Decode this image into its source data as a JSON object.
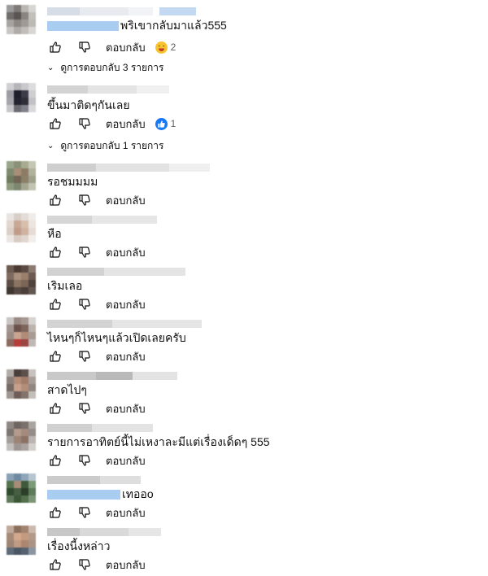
{
  "ui": {
    "reply_label": "ตอบกลับ"
  },
  "comments": [
    {
      "text": "พริเขากลับมาแล้ว555",
      "reaction_count": "2",
      "reaction_icon": "laughing-emoji-icon",
      "replies_label": "ดูการตอบกลับ 3 รายการ"
    },
    {
      "text": "ขึ้นมาติดๆกันเลย",
      "reaction_count": "1",
      "reaction_icon": "thumbs-up-reaction-icon",
      "replies_label": "ดูการตอบกลับ 1 รายการ"
    },
    {
      "text": "รอชมมมม"
    },
    {
      "text": "หือ"
    },
    {
      "text": "เริมเลอ"
    },
    {
      "text": "ไหนๆก็ไหนๆแล้วเปิดเลยครับ"
    },
    {
      "text": "สาดไปๆ"
    },
    {
      "text": "รายการอาทิตย์นี้ไม่เหงาละมีแต่เรื่องเด็ดๆ 555"
    },
    {
      "text": "เทออo"
    },
    {
      "text": "เรื่องนี้งหล่าว"
    }
  ],
  "colors": {
    "reaction_blue": "#1877f2",
    "emoji_yellow": "#f7c430",
    "mention_blur": "#a9cdf0"
  }
}
